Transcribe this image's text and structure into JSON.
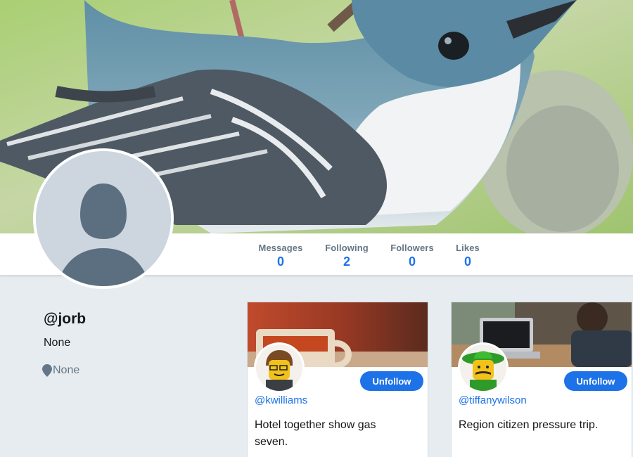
{
  "profile": {
    "handle": "@jorb",
    "bio": "None",
    "location": "None"
  },
  "stats": [
    {
      "label": "Messages",
      "value": "0"
    },
    {
      "label": "Following",
      "value": "2"
    },
    {
      "label": "Followers",
      "value": "0"
    },
    {
      "label": "Likes",
      "value": "0"
    }
  ],
  "following_cards": [
    {
      "username": "@kwilliams",
      "message": "Hotel together show gas seven.",
      "button_label": "Unfollow"
    },
    {
      "username": "@tiffanywilson",
      "message": "Region citizen pressure trip.",
      "button_label": "Unfollow"
    }
  ],
  "colors": {
    "accent": "#1d72e8",
    "background": "#e6ecf0",
    "muted_text": "#657786"
  },
  "icons": {
    "location": "map-pin-icon"
  }
}
